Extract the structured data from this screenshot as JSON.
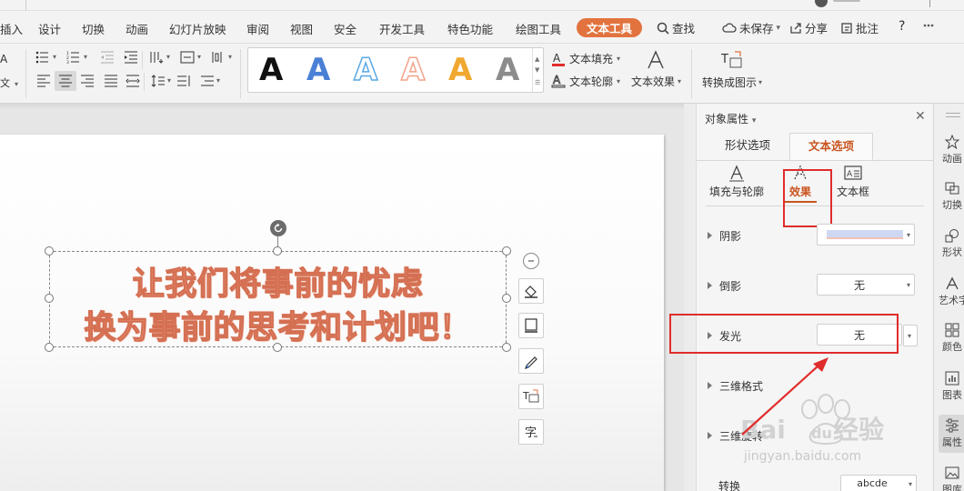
{
  "menu": {
    "items": [
      "插入",
      "设计",
      "切换",
      "动画",
      "幻灯片放映",
      "审阅",
      "视图",
      "安全",
      "开发工具",
      "特色功能",
      "绘图工具",
      "文本工具"
    ],
    "active": "文本工具",
    "search": "查找",
    "unsaved": "未保存",
    "share": "分享",
    "comment": "批注",
    "help": "?"
  },
  "ribbon": {
    "fill_label": "文本填充",
    "outline_label": "文本轮廓",
    "effect_label": "文本效果",
    "convert_label": "转换成图示",
    "gallery_letter": "A",
    "gallery_colors": [
      "#111111",
      "#4a80d6",
      "#5aa9e6",
      "#f2a38a",
      "#f0a830",
      "#8c8c8c"
    ]
  },
  "slide": {
    "line1": "让我们将事前的忧虑",
    "line2": "换为事前的思考和计划吧！"
  },
  "panel": {
    "title": "对象属性",
    "tab_shape": "形状选项",
    "tab_text": "文本选项",
    "sub_fill": "填充与轮廓",
    "sub_effect": "效果",
    "sub_textbox": "文本框",
    "sections": {
      "shadow": "阴影",
      "reflection": "倒影",
      "reflection_value": "无",
      "glow": "发光",
      "glow_value": "无",
      "threed_format": "三维格式",
      "threed_rotation": "三维旋转",
      "transform": "转换",
      "transform_value": "abcde"
    }
  },
  "sidebar": {
    "items": [
      "动画",
      "切换",
      "形状",
      "艺术字",
      "颜色",
      "图表",
      "属性",
      "图库"
    ]
  },
  "watermark": {
    "brand": "Baidu经验",
    "url": "jingyan.baidu.com"
  },
  "colors": {
    "accent": "#e2733f",
    "text_fill": "#ee9c82",
    "text_stroke": "#d46f52",
    "highlight_red": "#e02c2c"
  }
}
